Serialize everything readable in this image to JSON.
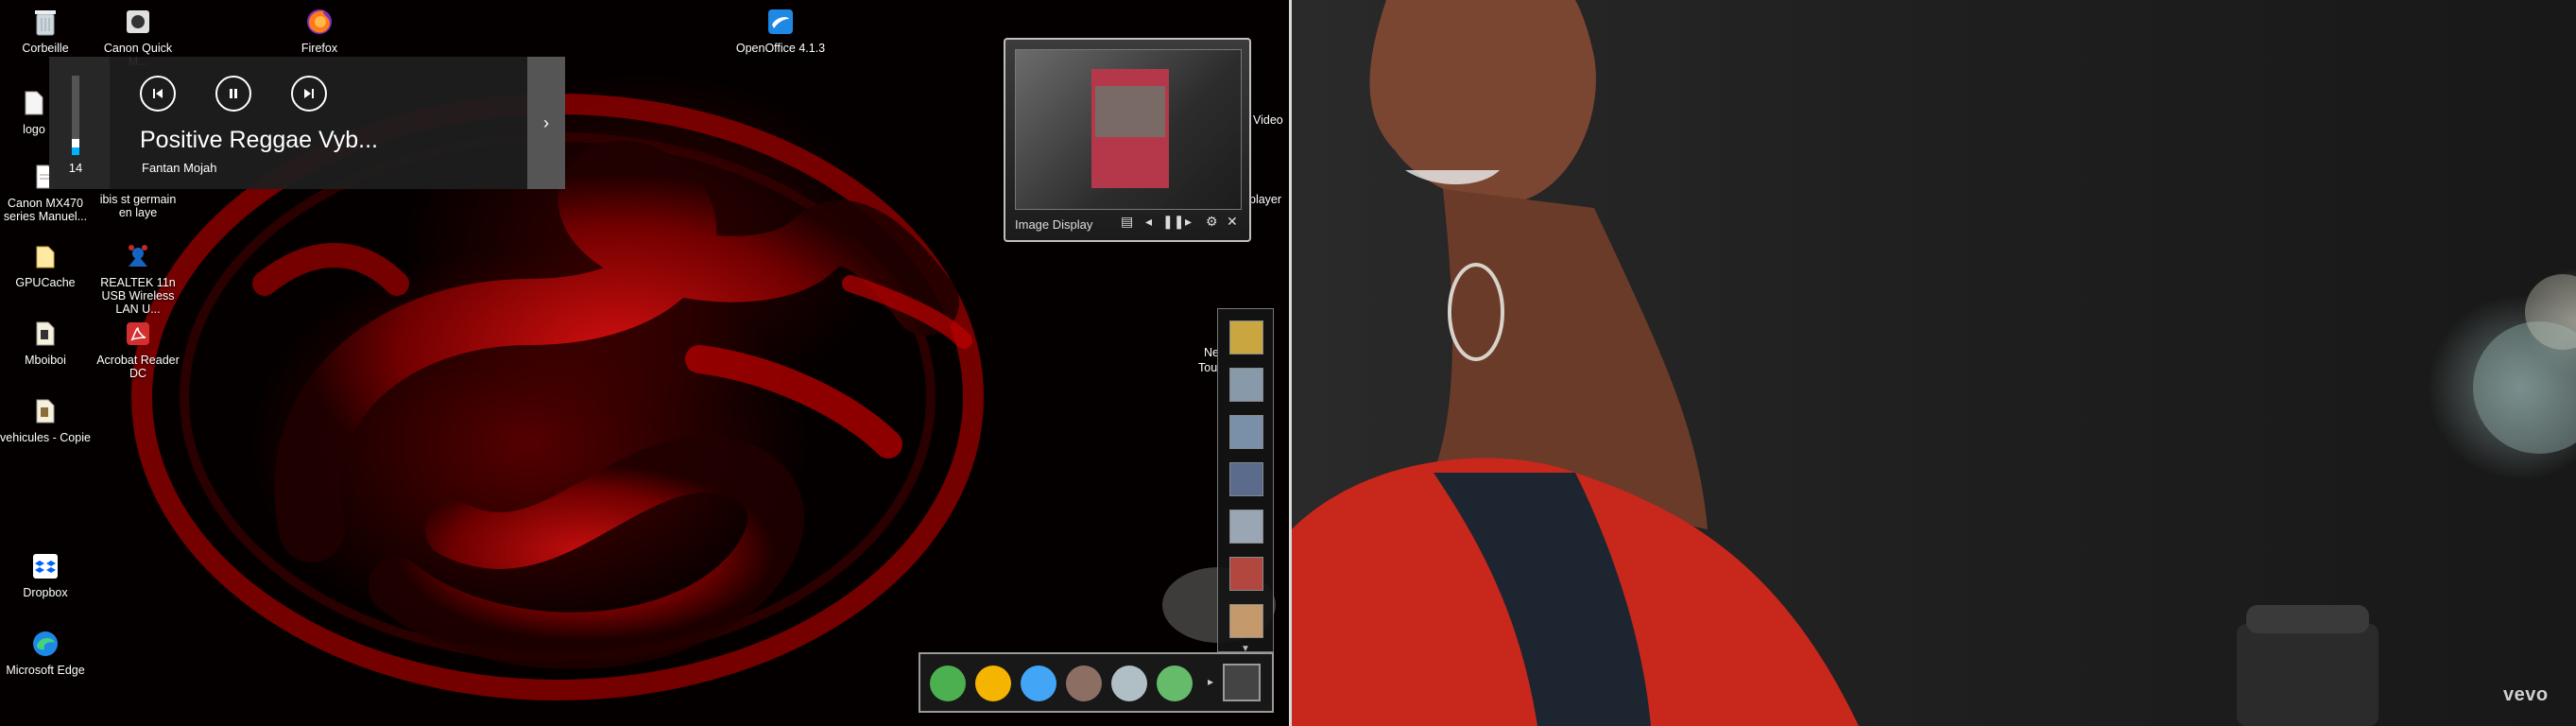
{
  "desktop": {
    "icons_col1": [
      {
        "label": "Corbeille",
        "icon": "recycle-bin-icon"
      },
      {
        "label": "logo",
        "icon": "file-icon"
      },
      {
        "label": "Canon MX470 series Manuel...",
        "icon": "document-icon"
      },
      {
        "label": "GPUCache",
        "icon": "folder-icon"
      },
      {
        "label": "Mboiboi",
        "icon": "document-icon"
      },
      {
        "label": "vehicules - Copie",
        "icon": "document-icon"
      },
      {
        "label": "Dropbox",
        "icon": "dropbox-icon"
      },
      {
        "label": "Microsoft Edge",
        "icon": "edge-icon"
      }
    ],
    "icons_col2": [
      {
        "label": "Canon Quick M...",
        "icon": "canon-icon"
      },
      {
        "label": "ibis st germain en laye",
        "icon": "document-icon"
      },
      {
        "label": "REALTEK 11n USB Wireless LAN U...",
        "icon": "network-icon"
      },
      {
        "label": "Acrobat Reader DC",
        "icon": "acrobat-icon"
      }
    ],
    "top_icons": [
      {
        "label": "Firefox",
        "icon": "firefox-icon"
      },
      {
        "label": "OpenOffice 4.1.3",
        "icon": "openoffice-icon"
      }
    ],
    "partial_labels": {
      "video": "Video",
      "player": "player",
      "ne": "Ne",
      "tou": "Tou"
    }
  },
  "media_overlay": {
    "volume": 14,
    "volume_level": 0.2,
    "title": "Positive Reggae Vyb...",
    "artist": "Fantan Mojah",
    "prev_icon": "skip-previous-icon",
    "pause_icon": "pause-icon",
    "next_icon": "skip-next-icon",
    "expand_icon": "chevron-right-icon"
  },
  "image_gadget": {
    "label": "Image Display"
  },
  "video": {
    "logo": "vevo"
  }
}
